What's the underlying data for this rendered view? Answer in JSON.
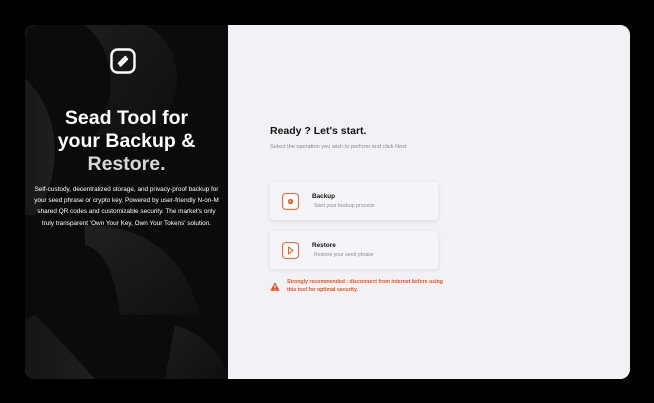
{
  "colors": {
    "accent": "#ee5a24",
    "warning": "#e4531e",
    "left_bg": "#0b0b0b",
    "right_bg": "#f2f1f5"
  },
  "sidebar": {
    "logo_icon": "seed-tool-logo-icon",
    "title_line1": "Sead Tool for",
    "title_line2": "your Backup &",
    "title_line3": "Restore.",
    "description": "Self-custody, decentralized storage, and privacy-proof backup for your seed phrase or crypto key. Powered by user-friendly N-on-M shared QR codes and customizable security. The market's only truly transparent 'Own Your Key, Own Your Tokens' solution."
  },
  "main": {
    "heading": "Ready ? Let's start.",
    "subheading": "Select the operation you wish to perform and click Next",
    "operations": [
      {
        "icon": "backup-icon",
        "title": "Backup",
        "description": "Start your backup process"
      },
      {
        "icon": "restore-icon",
        "title": "Restore",
        "description": "Restore your seed phrase"
      }
    ],
    "warning": {
      "icon": "warning-triangle-icon",
      "text": "Strongly recommended : disconnect from internet before using this tool for optimal security."
    }
  }
}
